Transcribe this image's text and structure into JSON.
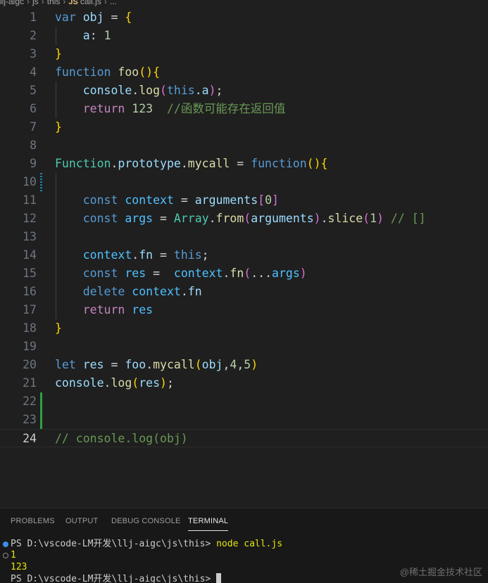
{
  "breadcrumb": {
    "items": [
      "llj-aigc",
      "js",
      "this",
      "call.js",
      "..."
    ],
    "file_badge": "JS"
  },
  "editor": {
    "lines": [
      {
        "n": "1"
      },
      {
        "n": "2"
      },
      {
        "n": "3"
      },
      {
        "n": "4"
      },
      {
        "n": "5"
      },
      {
        "n": "6"
      },
      {
        "n": "7"
      },
      {
        "n": "8"
      },
      {
        "n": "9"
      },
      {
        "n": "10"
      },
      {
        "n": "11"
      },
      {
        "n": "12"
      },
      {
        "n": "13"
      },
      {
        "n": "14"
      },
      {
        "n": "15"
      },
      {
        "n": "16"
      },
      {
        "n": "17"
      },
      {
        "n": "18"
      },
      {
        "n": "19"
      },
      {
        "n": "20"
      },
      {
        "n": "21"
      },
      {
        "n": "22"
      },
      {
        "n": "23"
      },
      {
        "n": "24"
      }
    ],
    "tokens": {
      "var": "var",
      "obj": "obj",
      "eq": " = ",
      "brace_open": "{",
      "brace_close": "}",
      "a_key": "a",
      "colon": ": ",
      "one": "1",
      "function": "function",
      "foo": "foo",
      "paren_open": "(",
      "paren_close": ")",
      "console": "console",
      "dot": ".",
      "log": "log",
      "this": "this",
      "a": "a",
      "semi": ";",
      "return": "return",
      "n123": "123",
      "comment6": "//函数可能存在返回值",
      "Function": "Function",
      "prototype": "prototype",
      "mycall": "mycall",
      "const": "const",
      "context": "context",
      "arguments": "arguments",
      "bracket_open": "[",
      "bracket_close": "]",
      "zero": "0",
      "args": "args",
      "Array": "Array",
      "from": "from",
      "slice": "slice",
      "comment12": "// []",
      "fn": "fn",
      "res": "res",
      "spread": "...",
      "delete": "delete",
      "let": "let",
      "four": "4",
      "five": "5",
      "comma": ",",
      "comment24": "// console.log(obj)"
    }
  },
  "panel": {
    "tabs": [
      "PROBLEMS",
      "OUTPUT",
      "DEBUG CONSOLE",
      "TERMINAL"
    ],
    "active_tab": "TERMINAL",
    "terminal": {
      "prompt1": "PS D:\\vscode-LM开发\\llj-aigc\\js\\this> ",
      "command": "node call.js",
      "output1": "1",
      "output2": "123",
      "prompt2": "PS D:\\vscode-LM开发\\llj-aigc\\js\\this> "
    }
  },
  "watermark": "@稀土掘金技术社区"
}
